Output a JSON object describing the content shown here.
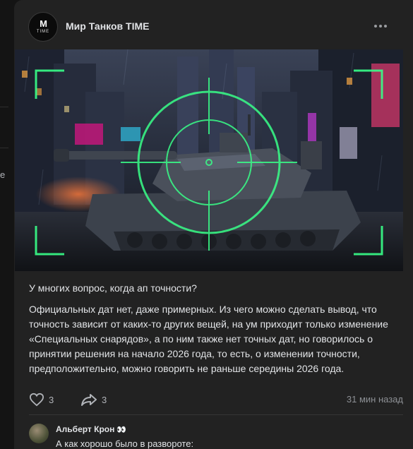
{
  "left_panel": {
    "fragment": "e"
  },
  "post": {
    "author": "Мир Танков TIME",
    "avatar": {
      "monogram": "M",
      "sub": "TIME"
    },
    "image": {
      "description_icon": "tank-crosshair-illustration"
    },
    "paragraphs": [
      "У многих вопрос, когда ап точности?",
      "Официальных дат нет, даже примерных. Из чего можно сделать вывод, что точность зависит от каких-то других вещей, на ум приходит только изменение «Специальных снарядов», а по ним также нет точных дат, но говорилось о принятии решения на начало 2026 года, то есть, о изменении точности, предположительно, можно говорить не раньше середины 2026 года."
    ],
    "likes": "3",
    "shares": "3",
    "timestamp": "31 мин назад"
  },
  "comment": {
    "author": "Альберт Крон",
    "author_emoji": "👀",
    "text": "А как хорошо было в развороте:"
  },
  "colors": {
    "card": "#222222",
    "page": "#141414",
    "text": "#e1e3e6",
    "muted": "#8d9095",
    "hud": "#39ff88"
  }
}
